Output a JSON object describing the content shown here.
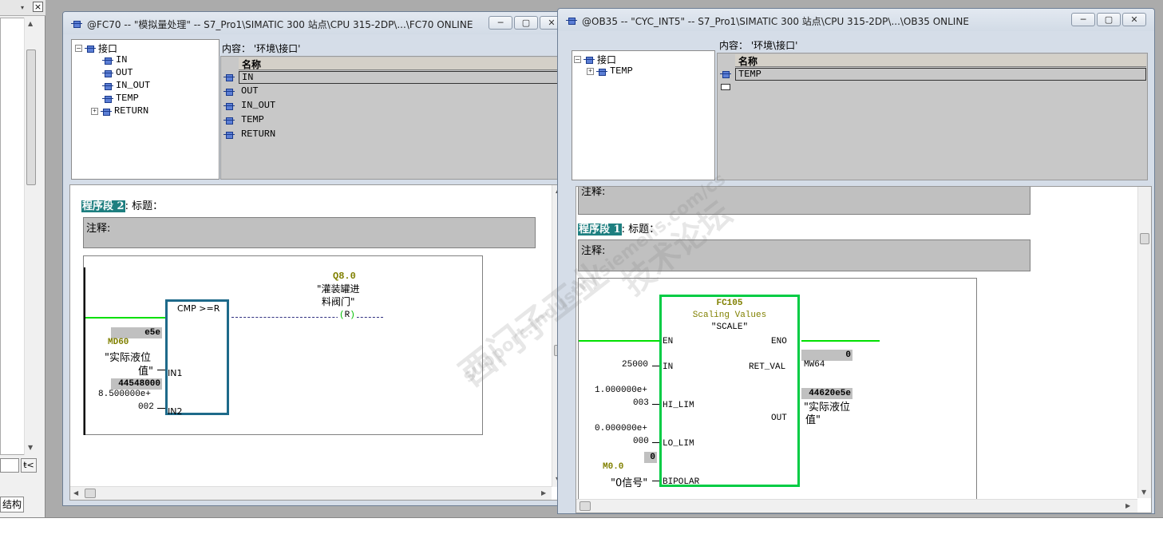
{
  "left_panel": {
    "close": "×",
    "tab_label": "结构",
    "btn_icon": "ŧ<"
  },
  "fc70": {
    "title": "@FC70 -- \"模拟量处理\" -- S7_Pro1\\SIMATIC 300 站点\\CPU 315-2DP\\...\\FC70  ONLINE",
    "content_label": "内容：  '环境\\接口'",
    "col_header": "名称",
    "tree": {
      "root": "接口",
      "items": [
        "IN",
        "OUT",
        "IN_OUT",
        "TEMP",
        "RETURN"
      ]
    },
    "rows": [
      "IN",
      "OUT",
      "IN_OUT",
      "TEMP",
      "RETURN"
    ],
    "network": {
      "label": "程序段 2",
      "title": ": 标题：",
      "comment": "注释:",
      "block": "CMP >=R",
      "coil_addr": "Q8.0",
      "coil_sym1": "\"灌装罐进",
      "coil_sym2": "料阀门\"",
      "coil": "R",
      "in1_val": "e5e",
      "in1_addr": "MD60",
      "in1_sym1": "\"实际液位",
      "in1_sym2": "值\"",
      "in1_pin": "IN1",
      "in2_val": "44548000",
      "in2_const1": "8.500000e+",
      "in2_const2": "002",
      "in2_pin": "IN2"
    }
  },
  "ob35": {
    "title": "@OB35 -- \"CYC_INT5\" -- S7_Pro1\\SIMATIC 300 站点\\CPU 315-2DP\\...\\OB35  ONLINE",
    "content_label": "内容：  '环境\\接口'",
    "col_header": "名称",
    "tree": {
      "root": "接口",
      "items": [
        "TEMP"
      ]
    },
    "rows": [
      "TEMP"
    ],
    "top_comment": "注释:",
    "network": {
      "label": "程序段 1",
      "title": ": 标题：",
      "comment": "注释:",
      "block_addr": "FC105",
      "block_name": "Scaling Values",
      "block_sym": "\"SCALE\"",
      "en": "EN",
      "eno": "ENO",
      "in_pin": "IN",
      "in_val": "25000",
      "hilim_pin": "HI_LIM",
      "hilim_val1": "1.000000e+",
      "hilim_val2": "003",
      "lolim_pin": "LO_LIM",
      "lolim_val1": "0.000000e+",
      "lolim_val2": "000",
      "bipolar_pin": "BIPOLAR",
      "bipolar_val": "0",
      "bipolar_addr": "M0.0",
      "bipolar_sym": "\"0信号\"",
      "retval_pin": "RET_VAL",
      "retval_val": "0",
      "retval_addr": "MW64",
      "out_pin": "OUT",
      "out_val": "44620e5e",
      "out_sym1": "\"实际液位",
      "out_sym2": "值\""
    }
  },
  "watermark": {
    "line1": "西门子工业",
    "line2": "技术论坛",
    "line3": "support.industry.siemens.com/cs"
  },
  "window_buttons": {
    "min": "─",
    "max": "▢",
    "close": "✕"
  }
}
